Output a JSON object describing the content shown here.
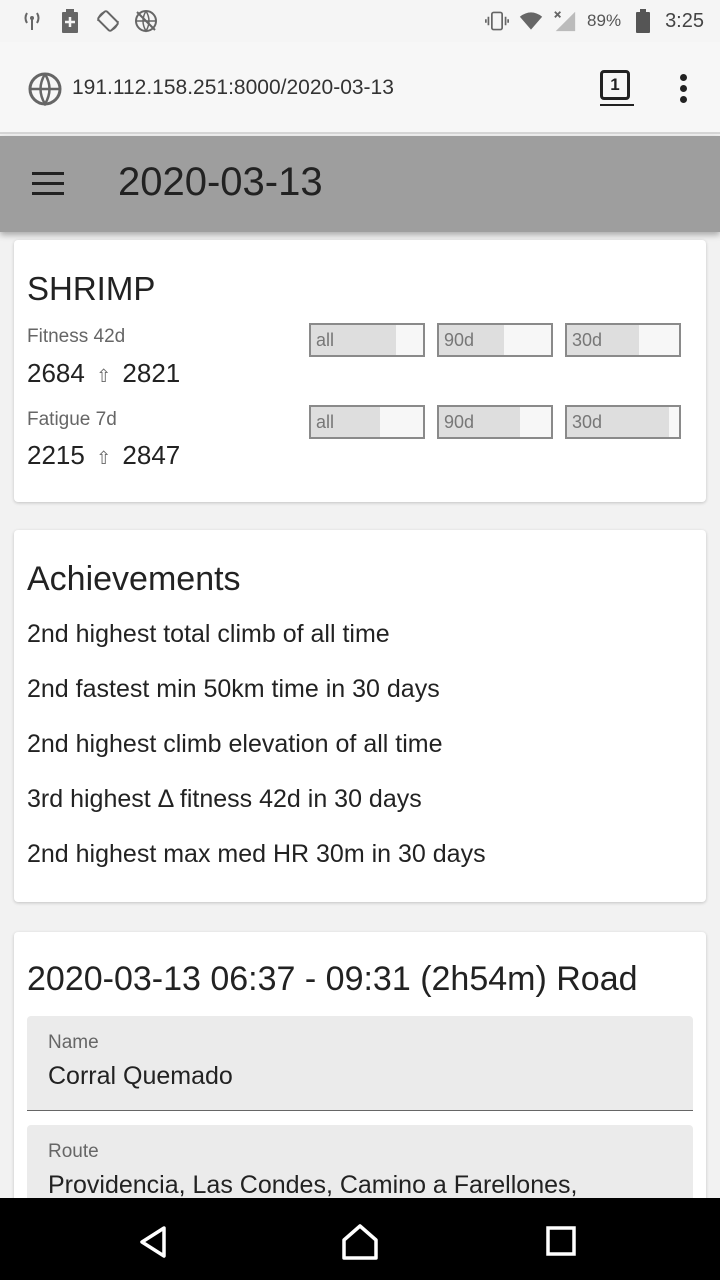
{
  "status_bar": {
    "battery_percent": "89%",
    "time": "3:25",
    "icons": [
      "signal-tower-icon",
      "battery-saver-icon",
      "rotation-icon",
      "globe-crossed-icon",
      "vibrate-icon",
      "wifi-icon",
      "cell-signal-icon",
      "battery-icon"
    ]
  },
  "browser": {
    "url": "191.112.158.251:8000/2020-03-13",
    "tab_count": "1"
  },
  "app_bar": {
    "title": "2020-03-13"
  },
  "athlete": {
    "name": "SHRIMP",
    "metrics": [
      {
        "label": "Fitness 42d",
        "from": "2684",
        "arrow": "⇧",
        "to": "2821",
        "bars": [
          {
            "label": "all",
            "fill": 0.76
          },
          {
            "label": "90d",
            "fill": 0.58
          },
          {
            "label": "30d",
            "fill": 0.64
          }
        ]
      },
      {
        "label": "Fatigue 7d",
        "from": "2215",
        "arrow": "⇧",
        "to": "2847",
        "bars": [
          {
            "label": "all",
            "fill": 0.62
          },
          {
            "label": "90d",
            "fill": 0.72
          },
          {
            "label": "30d",
            "fill": 0.91
          }
        ]
      }
    ]
  },
  "achievements": {
    "title": "Achievements",
    "items": [
      "2nd highest total climb of all time",
      "2nd fastest min 50km time in 30 days",
      "2nd highest climb elevation of all time",
      "3rd highest Δ fitness 42d in 30 days",
      "2nd highest max med HR 30m in 30 days"
    ]
  },
  "activity": {
    "title": "2020-03-13 06:37 - 09:31 (2h54m) Road",
    "fields": [
      {
        "label": "Name",
        "value": "Corral Quemado"
      },
      {
        "label": "Route",
        "value": "Providencia, Las Condes, Camino a Farellones,"
      }
    ]
  },
  "colors": {
    "app_bar": "#9e9e9e",
    "bar_fill": "#dedede",
    "field_bg": "#ebebeb"
  }
}
